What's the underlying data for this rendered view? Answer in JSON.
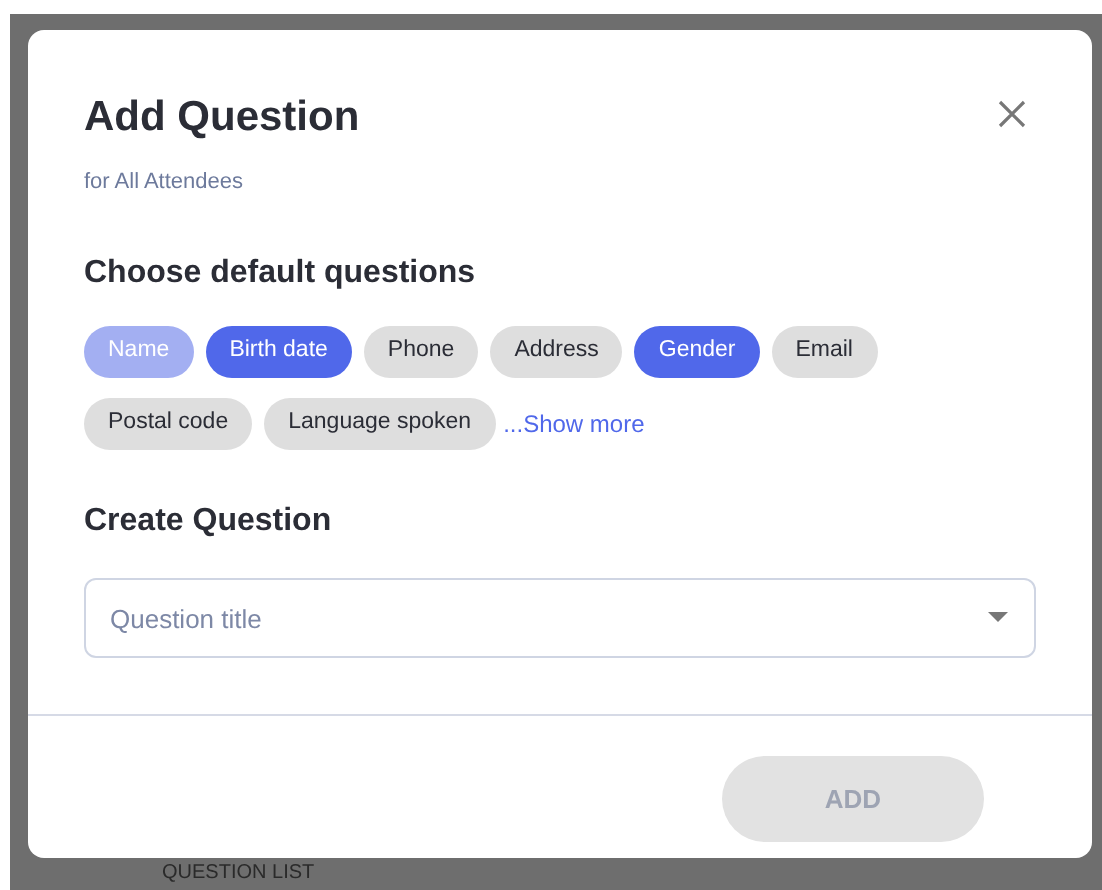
{
  "background": {
    "label": "QUESTION LIST"
  },
  "dialog": {
    "title": "Add Question",
    "subtitle": "for All Attendees",
    "defaults": {
      "heading": "Choose default questions",
      "chips": [
        {
          "label": "Name",
          "selected": true,
          "disabled": true
        },
        {
          "label": "Birth date",
          "selected": true,
          "disabled": false
        },
        {
          "label": "Phone",
          "selected": false,
          "disabled": false
        },
        {
          "label": "Address",
          "selected": false,
          "disabled": false
        },
        {
          "label": "Gender",
          "selected": true,
          "disabled": false
        },
        {
          "label": "Email",
          "selected": false,
          "disabled": false
        },
        {
          "label": "Postal code",
          "selected": false,
          "disabled": false
        },
        {
          "label": "Language spoken",
          "selected": false,
          "disabled": false
        }
      ],
      "show_more": "...Show more"
    },
    "create": {
      "heading": "Create Question",
      "placeholder": "Question title"
    },
    "add_button": {
      "label": "ADD",
      "disabled": true
    }
  }
}
